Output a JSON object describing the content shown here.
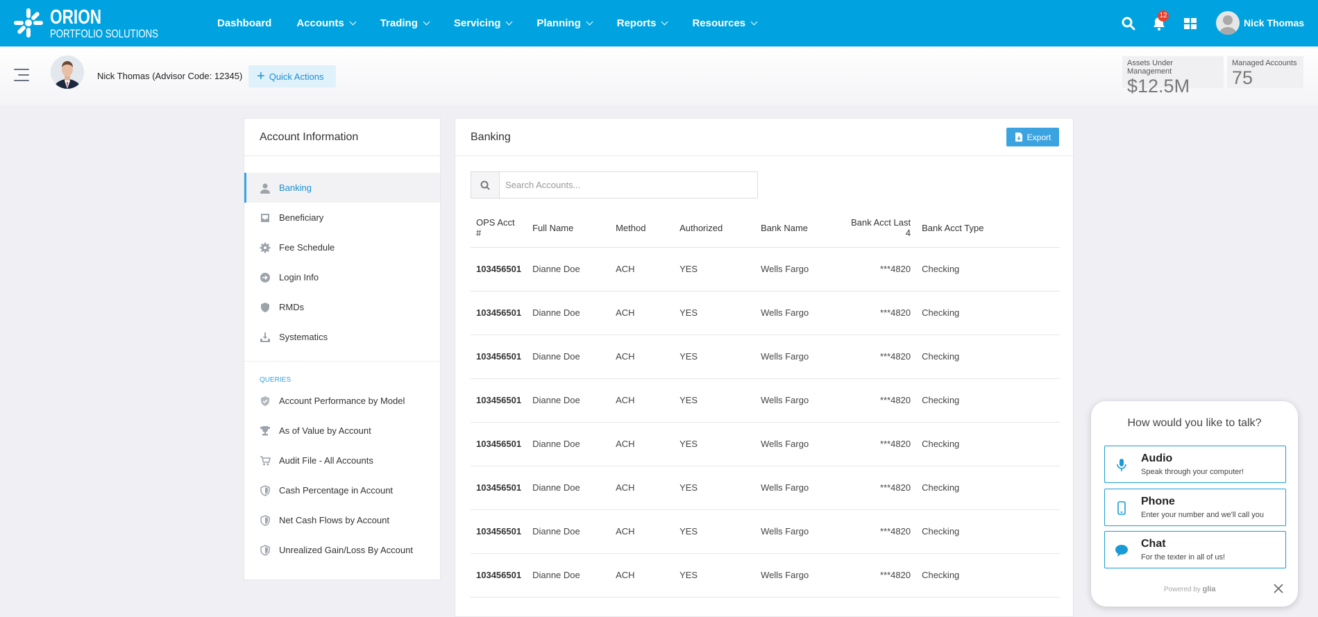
{
  "brand": {
    "name": "ORION",
    "subtitle": "PORTFOLIO SOLUTIONS"
  },
  "nav": {
    "items": [
      {
        "label": "Dashboard",
        "dropdown": false
      },
      {
        "label": "Accounts",
        "dropdown": true
      },
      {
        "label": "Trading",
        "dropdown": true
      },
      {
        "label": "Servicing",
        "dropdown": true
      },
      {
        "label": "Planning",
        "dropdown": true
      },
      {
        "label": "Reports",
        "dropdown": true
      },
      {
        "label": "Resources",
        "dropdown": true
      }
    ],
    "notification_count": "12",
    "user_name": "Nick Thomas"
  },
  "subheader": {
    "advisor_label": "Nick Thomas (Advisor Code: 12345)",
    "quick_actions_label": "Quick Actions",
    "aum_label": "Assets Under Management",
    "aum_value": "$12.5M",
    "managed_label": "Managed Accounts",
    "managed_value": "75"
  },
  "sidebar": {
    "title": "Account Information",
    "items": [
      {
        "label": "Banking",
        "icon": "user-icon",
        "active": true
      },
      {
        "label": "Beneficiary",
        "icon": "inbox-icon"
      },
      {
        "label": "Fee Schedule",
        "icon": "gear-icon"
      },
      {
        "label": "Login Info",
        "icon": "login-icon"
      },
      {
        "label": "RMDs",
        "icon": "shield-icon"
      },
      {
        "label": "Systematics",
        "icon": "download-tray-icon"
      }
    ],
    "queries_label": "QUERIES",
    "queries": [
      {
        "label": "Account Performance by Model",
        "icon": "hand-shield-icon"
      },
      {
        "label": "As of Value by Account",
        "icon": "trophy-icon"
      },
      {
        "label": "Audit File - All Accounts",
        "icon": "cart-icon"
      },
      {
        "label": "Cash Percentage in Account",
        "icon": "shield-icon"
      },
      {
        "label": "Net Cash Flows by Account",
        "icon": "shield-icon"
      },
      {
        "label": "Unrealized Gain/Loss By Account",
        "icon": "shield-icon"
      }
    ]
  },
  "main": {
    "title": "Banking",
    "export_label": "Export",
    "search_placeholder": "Search Accounts...",
    "columns": [
      "OPS Acct #",
      "Full Name",
      "Method",
      "Authorized",
      "Bank Name",
      "Bank Acct Last 4",
      "Bank Acct Type"
    ],
    "rows": [
      [
        "103456501",
        "Dianne Doe",
        "ACH",
        "YES",
        "Wells Fargo",
        "***4820",
        "Checking"
      ],
      [
        "103456501",
        "Dianne Doe",
        "ACH",
        "YES",
        "Wells Fargo",
        "***4820",
        "Checking"
      ],
      [
        "103456501",
        "Dianne Doe",
        "ACH",
        "YES",
        "Wells Fargo",
        "***4820",
        "Checking"
      ],
      [
        "103456501",
        "Dianne Doe",
        "ACH",
        "YES",
        "Wells Fargo",
        "***4820",
        "Checking"
      ],
      [
        "103456501",
        "Dianne Doe",
        "ACH",
        "YES",
        "Wells Fargo",
        "***4820",
        "Checking"
      ],
      [
        "103456501",
        "Dianne Doe",
        "ACH",
        "YES",
        "Wells Fargo",
        "***4820",
        "Checking"
      ],
      [
        "103456501",
        "Dianne Doe",
        "ACH",
        "YES",
        "Wells Fargo",
        "***4820",
        "Checking"
      ],
      [
        "103456501",
        "Dianne Doe",
        "ACH",
        "YES",
        "Wells Fargo",
        "***4820",
        "Checking"
      ]
    ]
  },
  "chat": {
    "title": "How would you like to talk?",
    "options": [
      {
        "title": "Audio",
        "subtitle": "Speak through your computer!",
        "icon": "microphone-icon"
      },
      {
        "title": "Phone",
        "subtitle": "Enter your number and we'll call you",
        "icon": "phone-icon"
      },
      {
        "title": "Chat",
        "subtitle": "For the texter in all of us!",
        "icon": "chat-bubble-icon"
      }
    ],
    "powered_by": "Powered by",
    "powered_brand": "glia"
  },
  "colors": {
    "brand_blue": "#00a3e0",
    "accent": "#3aa3e0",
    "badge": "#e8402d"
  }
}
